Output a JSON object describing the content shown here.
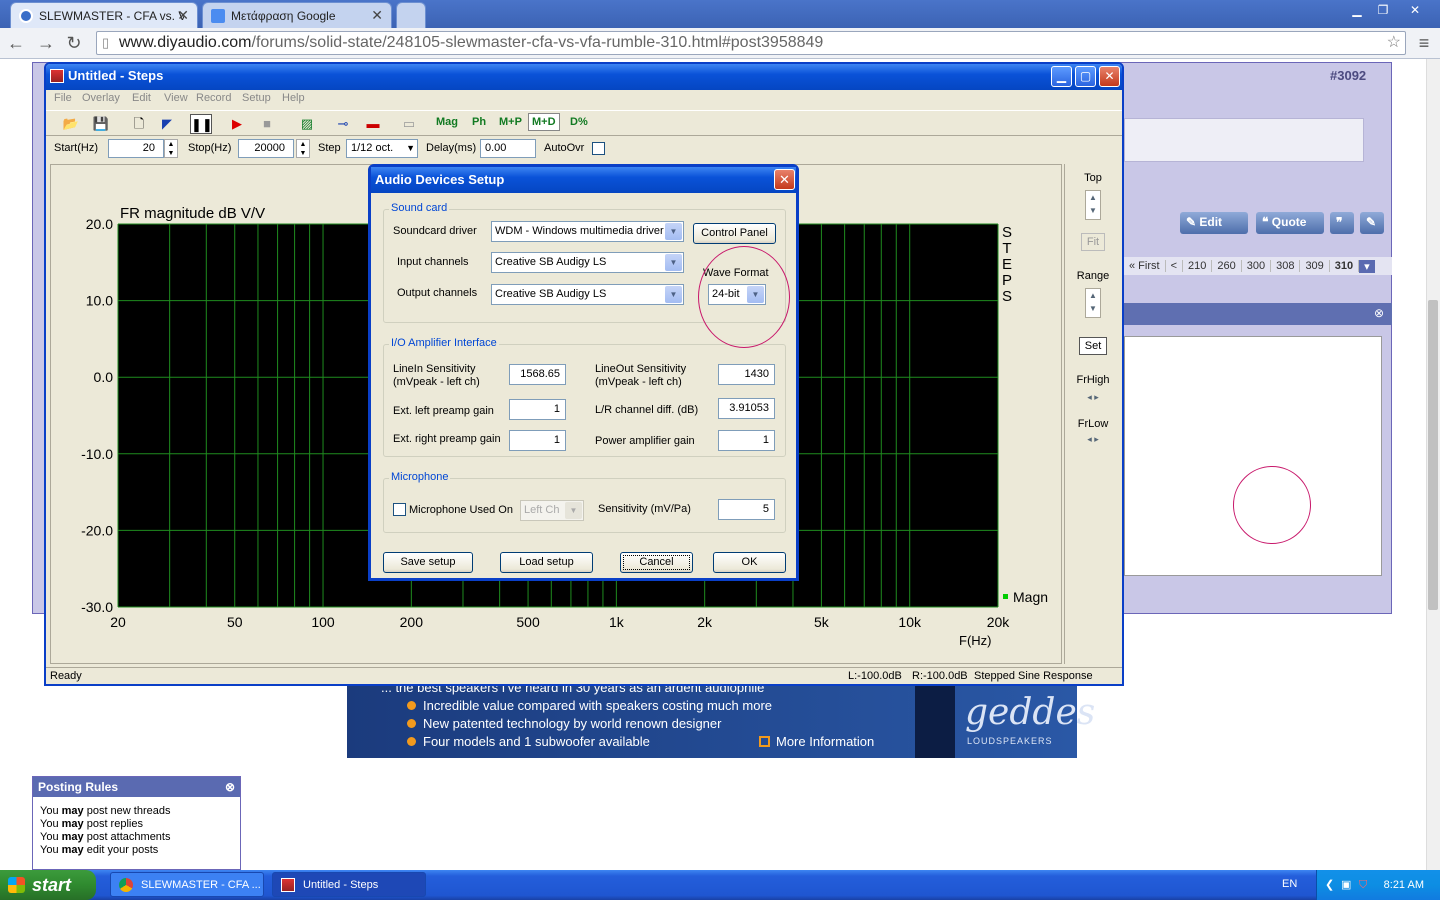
{
  "browser": {
    "tabs": [
      {
        "title": "SLEWMASTER - CFA vs. VFA"
      },
      {
        "title": "Μετάφραση Google"
      }
    ],
    "url_domain": "www.diyaudio.com",
    "url_path": "/forums/solid-state/248105-slewmaster-cfa-vs-vfa-rumble-310.html#post3958849"
  },
  "forum": {
    "post_number": "#3092",
    "edit_label": "Edit",
    "quote_label": "Quote",
    "pager": [
      "« First",
      "<",
      "210",
      "260",
      "300",
      "308",
      "309",
      "310"
    ],
    "ad": {
      "headline": "... the best speakers I've heard in 30 years as an ardent audiophile",
      "bullets": [
        "Incredible value compared with speakers costing much more",
        "New patented technology by world renown designer",
        "Four models and 1 subwoofer available"
      ],
      "more": "More Information",
      "brand": "geddes",
      "brand_sub": "LOUDSPEAKERS"
    },
    "posting_rules": {
      "title": "Posting Rules",
      "lines": [
        {
          "pre": "You ",
          "bold": "may",
          "post": " post new threads"
        },
        {
          "pre": "You ",
          "bold": "may",
          "post": " post replies"
        },
        {
          "pre": "You ",
          "bold": "may",
          "post": " post attachments"
        },
        {
          "pre": "You ",
          "bold": "may",
          "post": " edit your posts"
        }
      ]
    }
  },
  "steps": {
    "title": "Untitled - Steps",
    "menu": [
      "File",
      "Overlay",
      "Edit",
      "View",
      "Record",
      "Setup",
      "Help"
    ],
    "tool_labels": {
      "mag": "Mag",
      "ph": "Ph",
      "mp": "M+P",
      "md": "M+D",
      "dpct": "D%"
    },
    "params": {
      "start_label": "Start(Hz)",
      "start": "20",
      "stop_label": "Stop(Hz)",
      "stop": "20000",
      "step_label": "Step",
      "step": "1/12 oct.",
      "delay_label": "Delay(ms)",
      "delay": "0.00",
      "autoovr_label": "AutoOvr"
    },
    "side": {
      "top": "Top",
      "fit": "Fit",
      "range": "Range",
      "set": "Set",
      "frhigh": "FrHigh",
      "frlow": "FrLow"
    },
    "status": {
      "left": "Ready",
      "l": "L:-100.0dB",
      "r": "R:-100.0dB",
      "mode": "Stepped Sine Response"
    }
  },
  "chart_data": {
    "type": "line",
    "title": "FR magnitude dB V/V",
    "xlabel": "F(Hz)",
    "ylabel": "",
    "xscale": "log",
    "xlim": [
      20,
      20000
    ],
    "ylim": [
      -30,
      20
    ],
    "x_ticks": [
      "20",
      "50",
      "100",
      "200",
      "500",
      "1k",
      "2k",
      "5k",
      "10k",
      "20k"
    ],
    "x_tick_values": [
      20,
      50,
      100,
      200,
      500,
      1000,
      2000,
      5000,
      10000,
      20000
    ],
    "y_ticks": [
      "20.0",
      "10.0",
      "0.0",
      "-10.0",
      "-20.0",
      "-30.0"
    ],
    "y_tick_values": [
      20,
      10,
      0,
      -10,
      -20,
      -30
    ],
    "grid": true,
    "background": "#000000",
    "grid_color": "#1f8c1f",
    "series": [
      {
        "name": "Magn",
        "color": "#00cc00",
        "values": []
      }
    ],
    "side_text": "STEPS"
  },
  "dialog": {
    "title": "Audio Devices Setup",
    "soundcard_group": "Sound card",
    "soundcard_driver_label": "Soundcard driver",
    "soundcard_driver": "WDM - Windows multimedia driver",
    "control_panel": "Control Panel",
    "input_channels_label": "Input channels",
    "input_channels": "Creative SB Audigy LS",
    "output_channels_label": "Output channels",
    "output_channels": "Creative SB Audigy LS",
    "wave_format_label": "Wave Format",
    "wave_format": "24-bit",
    "io_group": "I/O Amplifier Interface",
    "linein_label": "LineIn Sensitivity",
    "linein_sub": "(mVpeak - left ch)",
    "linein": "1568.65",
    "lineout_label": "LineOut Sensitivity",
    "lineout_sub": "(mVpeak - left ch)",
    "lineout": "1430",
    "ext_left_label": "Ext. left preamp gain",
    "ext_left": "1",
    "lr_diff_label": "L/R channel diff. (dB)",
    "lr_diff": "3.91053",
    "ext_right_label": "Ext. right preamp gain",
    "ext_right": "1",
    "power_amp_label": "Power amplifier gain",
    "power_amp": "1",
    "mic_group": "Microphone",
    "mic_used_label": "Microphone Used On",
    "mic_channel": "Left Ch",
    "sensitivity_label": "Sensitivity (mV/Pa)",
    "sensitivity": "5",
    "save_setup": "Save setup",
    "load_setup": "Load setup",
    "cancel": "Cancel",
    "ok": "OK"
  },
  "taskbar": {
    "start": "start",
    "tasks": [
      "SLEWMASTER - CFA ...",
      "Untitled - Steps"
    ],
    "lang": "EN",
    "clock": "8:21 AM"
  }
}
